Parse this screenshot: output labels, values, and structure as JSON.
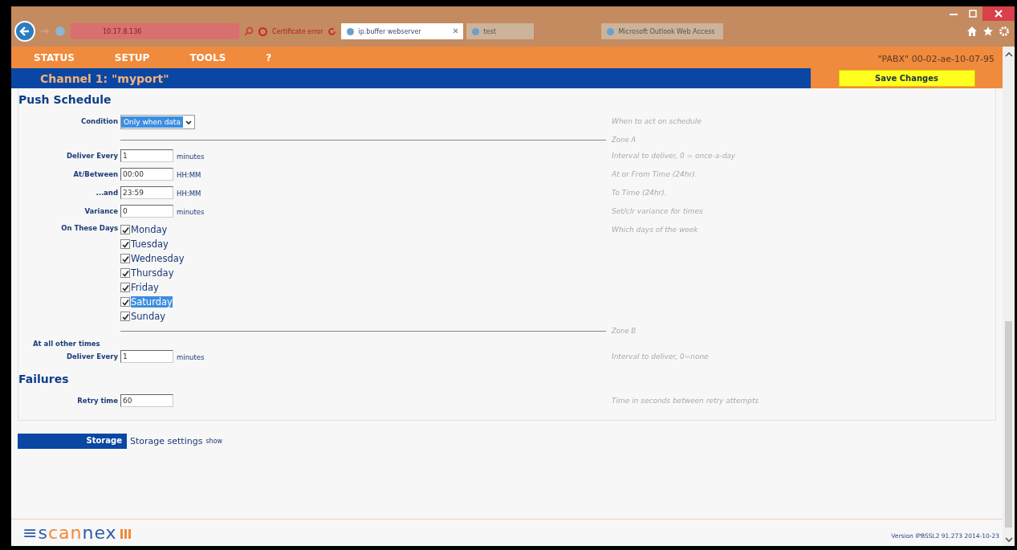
{
  "browser": {
    "address": "10.17.8.136",
    "cert_warning": "Certificate error",
    "tabs": [
      {
        "label": "ip.buffer webserver",
        "selected": true
      },
      {
        "label": "test",
        "selected": false
      },
      {
        "label": "Microsoft Outlook Web Access",
        "selected": false
      }
    ]
  },
  "menu": [
    "STATUS",
    "SETUP",
    "TOOLS",
    "?"
  ],
  "device": "\"PABX\" 00-02-ae-10-07-95",
  "channel_title": "Channel 1: \"myport\"",
  "save_button": "Save Changes",
  "sections": [
    {
      "title": "Push Schedule",
      "rows": [
        {
          "kind": "select",
          "label": "Condition",
          "value": "Only when data",
          "hint": "When to act on schedule"
        },
        {
          "kind": "zone",
          "hint": "Zone A"
        },
        {
          "kind": "input",
          "label": "Deliver Every",
          "value": "1",
          "unit": "minutes",
          "hint": "Interval to deliver, 0 = once-a-day"
        },
        {
          "kind": "input",
          "label": "At/Between",
          "value": "00:00",
          "unit": "HH:MM",
          "hint": "At or From Time (24hr)."
        },
        {
          "kind": "input",
          "label": "...and",
          "value": "23:59",
          "unit": "HH:MM",
          "hint": "To Time (24hr)."
        },
        {
          "kind": "input",
          "label": "Variance",
          "value": "0",
          "unit": "minutes",
          "hint": "Set/clr variance for times"
        },
        {
          "kind": "days",
          "label": "On These Days",
          "hint": "Which days of the week",
          "days": [
            {
              "label": "Monday",
              "checked": true,
              "highlighted": false
            },
            {
              "label": "Tuesday",
              "checked": true,
              "highlighted": false
            },
            {
              "label": "Wednesday",
              "checked": true,
              "highlighted": false
            },
            {
              "label": "Thursday",
              "checked": true,
              "highlighted": false
            },
            {
              "label": "Friday",
              "checked": true,
              "highlighted": false
            },
            {
              "label": "Saturday",
              "checked": true,
              "highlighted": true
            },
            {
              "label": "Sunday",
              "checked": true,
              "highlighted": false
            }
          ]
        },
        {
          "kind": "zone",
          "hint": "Zone B"
        },
        {
          "kind": "subhead",
          "label": "At all other times"
        },
        {
          "kind": "input",
          "label": "Deliver Every",
          "value": "1",
          "unit": "minutes",
          "hint": "Interval to deliver, 0=none"
        }
      ]
    },
    {
      "title": "Failures",
      "rows": [
        {
          "kind": "input",
          "label": "Retry time",
          "value": "60",
          "hint": "Time in seconds between retry attempts"
        }
      ]
    }
  ],
  "storage": {
    "label": "Storage",
    "text": "Storage settings",
    "link": "show"
  },
  "logo": [
    {
      "text": "≡s",
      "color": "#2f5da8"
    },
    {
      "text": "can",
      "color": "#f08a3c"
    },
    {
      "text": "nex",
      "color": "#2f5da8"
    }
  ],
  "version": "Version IPBSSL2 91.273 2014-10-23"
}
